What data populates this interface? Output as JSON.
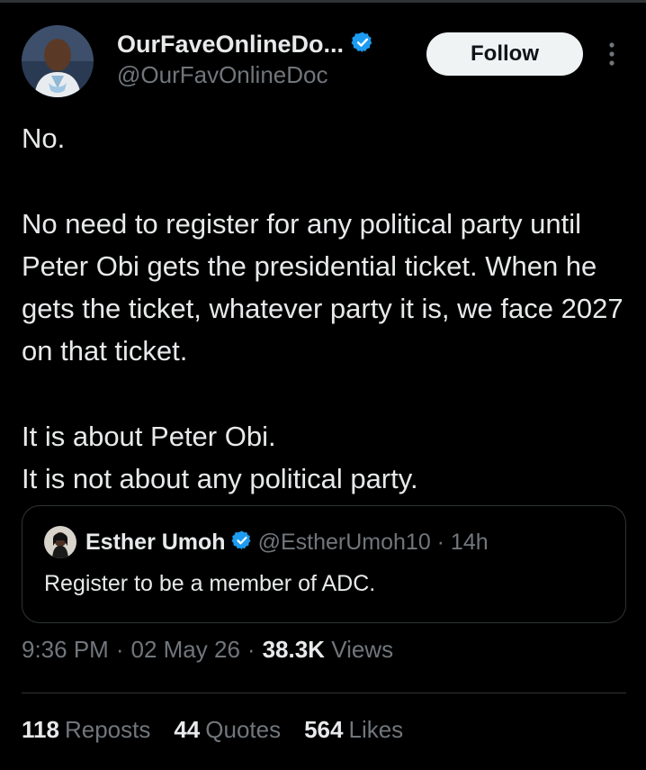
{
  "author": {
    "display_name": "OurFaveOnlineDo...",
    "handle": "@OurFavOnlineDoc",
    "verified": true
  },
  "follow_label": "Follow",
  "icons": {
    "more": "more-vertical-icon",
    "verified": "verified-badge-icon"
  },
  "tweet": {
    "paragraphs": [
      "No.",
      "No need to register for any political party until Peter Obi gets the presidential ticket. When he gets the ticket, whatever party it is, we face 2027 on that ticket.",
      "It is about Peter Obi.",
      "It is not about any political party."
    ]
  },
  "quoted": {
    "name": "Esther Umoh",
    "handle_time": "@EstherUmoh10 · 14h",
    "text": "Register to be a member of ADC."
  },
  "meta": {
    "time": "9:36 PM",
    "sep1": "·",
    "date": "02 May 26",
    "sep2": "·",
    "views_count": "38.3K",
    "views_label": "Views"
  },
  "stats": {
    "reposts_count": "118",
    "reposts_label": "Reposts",
    "quotes_count": "44",
    "quotes_label": "Quotes",
    "likes_count": "564",
    "likes_label": "Likes"
  },
  "colors": {
    "background": "#000000",
    "text": "#e7e9ea",
    "secondary": "#71767b",
    "border": "#2f3336",
    "verified": "#1d9bf0",
    "button_bg": "#eff3f4"
  }
}
